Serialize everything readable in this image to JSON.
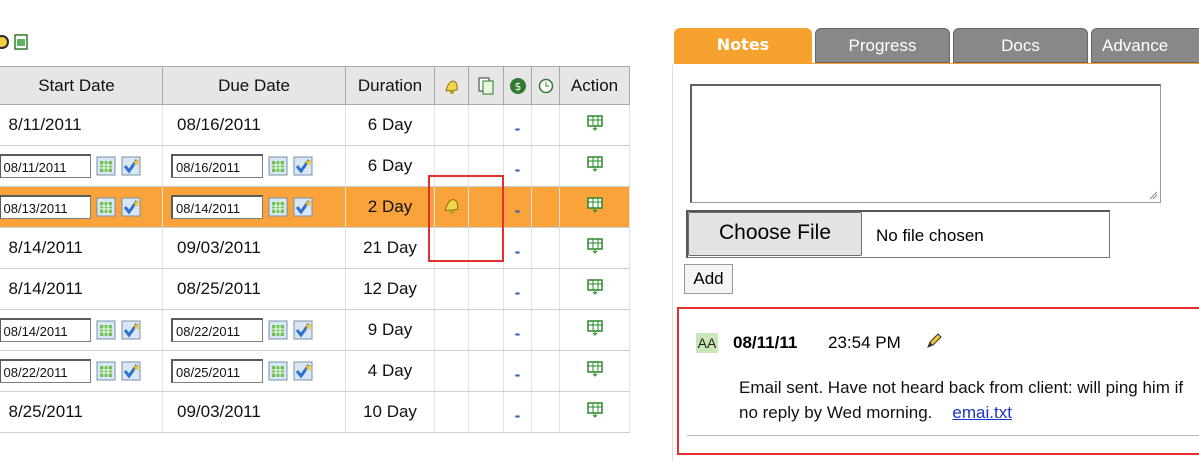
{
  "grid": {
    "headers": {
      "start": "Start Date",
      "due": "Due Date",
      "duration": "Duration",
      "action": "Action"
    },
    "rows": [
      {
        "start": "8/11/2011",
        "due": "08/16/2011",
        "duration": "6 Day",
        "edit": false,
        "highlight": false
      },
      {
        "start": "08/11/2011",
        "due": "08/16/2011",
        "duration": "6 Day",
        "edit": true,
        "highlight": false
      },
      {
        "start": "08/13/2011",
        "due": "08/14/2011",
        "duration": "2 Day",
        "edit": true,
        "highlight": true
      },
      {
        "start": "8/14/2011",
        "due": "09/03/2011",
        "duration": "21 Day",
        "edit": false,
        "highlight": false
      },
      {
        "start": "8/14/2011",
        "due": "08/25/2011",
        "duration": "12 Day",
        "edit": false,
        "highlight": false
      },
      {
        "start": "08/14/2011",
        "due": "08/22/2011",
        "duration": "9 Day",
        "edit": true,
        "highlight": false
      },
      {
        "start": "08/22/2011",
        "due": "08/25/2011",
        "duration": "4 Day",
        "edit": true,
        "highlight": false
      },
      {
        "start": "8/25/2011",
        "due": "09/03/2011",
        "duration": "10 Day",
        "edit": false,
        "highlight": false
      }
    ],
    "dash": "-",
    "highlight_color": "#f9a33a"
  },
  "tabs": [
    {
      "label": "Notes",
      "active": true
    },
    {
      "label": "Progress",
      "active": false
    },
    {
      "label": "Docs",
      "active": false
    },
    {
      "label": "Advance",
      "active": false
    }
  ],
  "notes": {
    "choose_file_label": "Choose File",
    "file_status": "No file chosen",
    "add_label": "Add",
    "entry": {
      "initials": "AA",
      "date": "08/11/11",
      "time": "23:54 PM",
      "text": "Email sent. Have not heard back from client: will ping him if no reply by Wed morning.",
      "attachment": "emai.txt"
    }
  },
  "colors": {
    "accent": "#f7a12e",
    "annotation_red": "#e03030",
    "link": "#1a36c8"
  }
}
